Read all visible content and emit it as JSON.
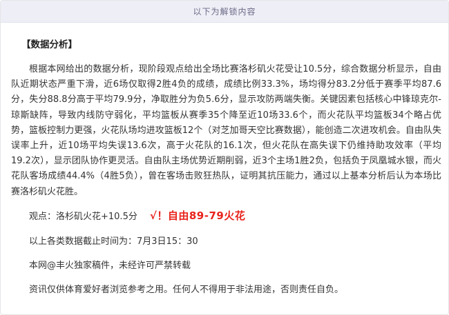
{
  "banner": {
    "text": "以下为解锁内容"
  },
  "section_title": "【数据分析】",
  "analysis_paragraph": "根据本网给出的数据分析，现阶段观点给出全场比赛洛杉矶火花受让10.5分，综合数据分析显示，自由队近期状态严重下滑，近6场仅取得2胜4负的成绩，成绩比例33.3%，场均得分83.2分低于赛季平均87.6分，失分88.8分高于平均79.9分，净取胜分为负5.6分，显示攻防两端失衡。关键因素包括核心中锋琼克尔-琼斯缺阵，导致内线防守弱化，平均篮板从赛季35个降至近10场33.6个，而火花队平均篮板34个略占优势，篮板控制力更强，火花队场均进攻篮板12个（对芝加哥天空比赛数据），能创造二次进攻机会。自由队失误率上升，近10场平均失误13.6次，高于火花队的16.1次，但火花队在高失误下仍维持助攻效率（平均19.2次），显示团队协作更灵活。自由队主场优势近期削弱，近3个主场1胜2负，包括负于凤凰城水银，而火花队客场成绩44.4%（4胜5负），曾在客场击败狂热队，证明其抗压能力，通过以上基本分析后认为本场比赛洛杉矶火花胜。",
  "viewpoint": {
    "label": "观点：洛杉矶火花+10.5分",
    "result": "√！自由89-79火花",
    "result_color": "#e8221b"
  },
  "cutoff_time": "以上各类数据截止时间为：7月3日15：30",
  "copyright": "本网@丰火独家稿件，未经许可严禁转载",
  "disclaimer": "资讯仅供体育爱好者浏览参考之用。任何人不得用于非法用途，否则责任自负。"
}
